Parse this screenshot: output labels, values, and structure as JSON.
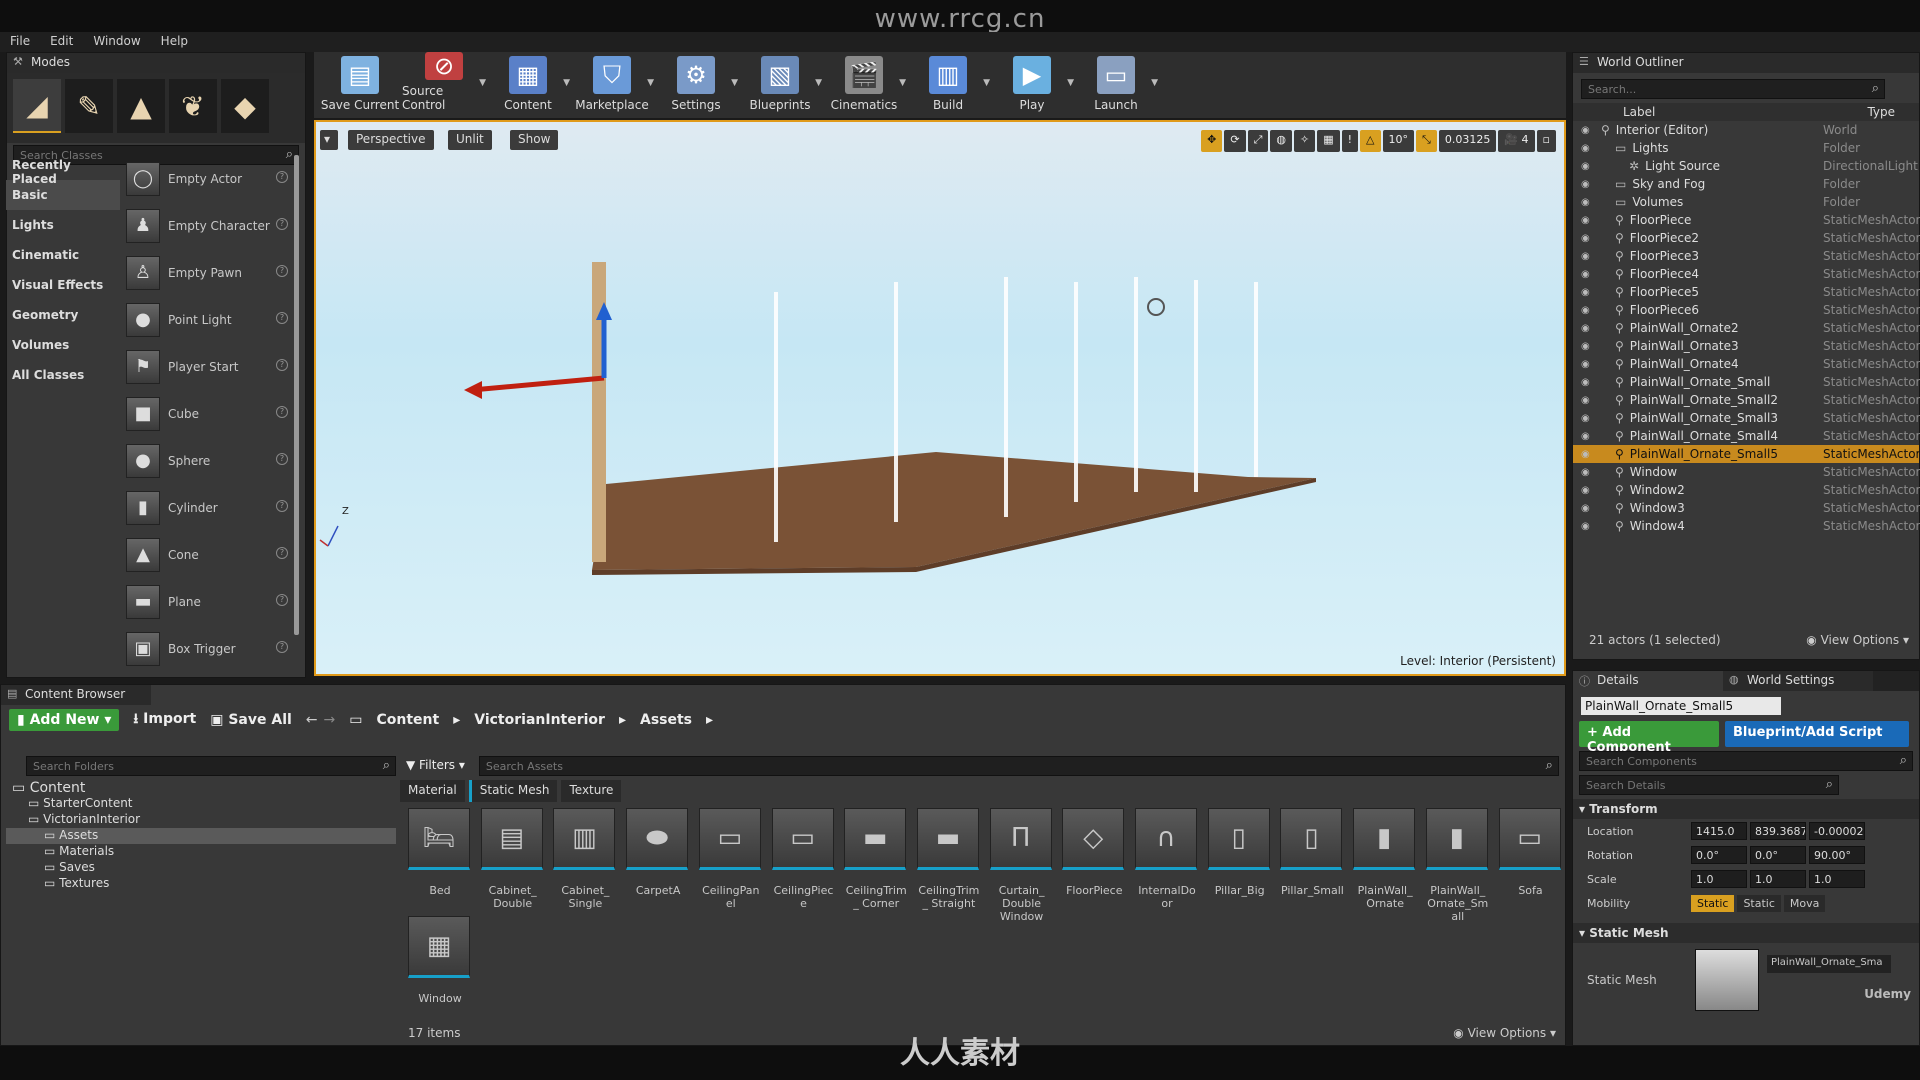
{
  "watermark": "www.rrcg.cn",
  "bottom_logo": "人人素材",
  "menu": [
    "File",
    "Edit",
    "Window",
    "Help"
  ],
  "modes": {
    "title": "Modes",
    "search_placeholder": "Search Classes",
    "categories": [
      "Recently Placed",
      "Basic",
      "Lights",
      "Cinematic",
      "Visual Effects",
      "Geometry",
      "Volumes",
      "All Classes"
    ],
    "selected_category": "Basic",
    "items": [
      "Empty Actor",
      "Empty Character",
      "Empty Pawn",
      "Point Light",
      "Player Start",
      "Cube",
      "Sphere",
      "Cylinder",
      "Cone",
      "Plane",
      "Box Trigger"
    ]
  },
  "toolbar": [
    {
      "label": "Save Current",
      "icon": "save-icon",
      "color": "#7fb2e0"
    },
    {
      "label": "Source Control",
      "icon": "source-control-icon",
      "color": "#c04040"
    },
    {
      "label": "Content",
      "icon": "content-icon",
      "color": "#5a80c8"
    },
    {
      "label": "Marketplace",
      "icon": "marketplace-icon",
      "color": "#6a9ad8"
    },
    {
      "label": "Settings",
      "icon": "settings-icon",
      "color": "#7a9ac8"
    },
    {
      "label": "Blueprints",
      "icon": "blueprints-icon",
      "color": "#6a8ab8"
    },
    {
      "label": "Cinematics",
      "icon": "cinematics-icon",
      "color": "#8a8a8a"
    },
    {
      "label": "Build",
      "icon": "build-icon",
      "color": "#5a8ad8"
    },
    {
      "label": "Play",
      "icon": "play-icon",
      "color": "#6ab0e0"
    },
    {
      "label": "Launch",
      "icon": "launch-icon",
      "color": "#8aa0c0"
    }
  ],
  "viewport": {
    "perspective": "Perspective",
    "unlit": "Unlit",
    "show": "Show",
    "rotation_snap": "10°",
    "scale_snap": "0.03125",
    "camera_speed": "4",
    "level_label": "Level:",
    "level_name": "Interior (Persistent)",
    "axis": "Z"
  },
  "outliner": {
    "title": "World Outliner",
    "search_placeholder": "Search...",
    "col_label": "Label",
    "col_type": "Type",
    "rows": [
      {
        "label": "Interior (Editor)",
        "type": "World",
        "indent": 0,
        "sel": false
      },
      {
        "label": "Lights",
        "type": "Folder",
        "indent": 1,
        "sel": false
      },
      {
        "label": "Light Source",
        "type": "DirectionalLight",
        "indent": 2,
        "sel": false
      },
      {
        "label": "Sky and Fog",
        "type": "Folder",
        "indent": 1,
        "sel": false
      },
      {
        "label": "Volumes",
        "type": "Folder",
        "indent": 1,
        "sel": false
      },
      {
        "label": "FloorPiece",
        "type": "StaticMeshActor",
        "indent": 1,
        "sel": false
      },
      {
        "label": "FloorPiece2",
        "type": "StaticMeshActor",
        "indent": 1,
        "sel": false
      },
      {
        "label": "FloorPiece3",
        "type": "StaticMeshActor",
        "indent": 1,
        "sel": false
      },
      {
        "label": "FloorPiece4",
        "type": "StaticMeshActor",
        "indent": 1,
        "sel": false
      },
      {
        "label": "FloorPiece5",
        "type": "StaticMeshActor",
        "indent": 1,
        "sel": false
      },
      {
        "label": "FloorPiece6",
        "type": "StaticMeshActor",
        "indent": 1,
        "sel": false
      },
      {
        "label": "PlainWall_Ornate2",
        "type": "StaticMeshActor",
        "indent": 1,
        "sel": false
      },
      {
        "label": "PlainWall_Ornate3",
        "type": "StaticMeshActor",
        "indent": 1,
        "sel": false
      },
      {
        "label": "PlainWall_Ornate4",
        "type": "StaticMeshActor",
        "indent": 1,
        "sel": false
      },
      {
        "label": "PlainWall_Ornate_Small",
        "type": "StaticMeshActor",
        "indent": 1,
        "sel": false
      },
      {
        "label": "PlainWall_Ornate_Small2",
        "type": "StaticMeshActor",
        "indent": 1,
        "sel": false
      },
      {
        "label": "PlainWall_Ornate_Small3",
        "type": "StaticMeshActor",
        "indent": 1,
        "sel": false
      },
      {
        "label": "PlainWall_Ornate_Small4",
        "type": "StaticMeshActor",
        "indent": 1,
        "sel": false
      },
      {
        "label": "PlainWall_Ornate_Small5",
        "type": "StaticMeshActor",
        "indent": 1,
        "sel": true
      },
      {
        "label": "Window",
        "type": "StaticMeshActor",
        "indent": 1,
        "sel": false
      },
      {
        "label": "Window2",
        "type": "StaticMeshActor",
        "indent": 1,
        "sel": false
      },
      {
        "label": "Window3",
        "type": "StaticMeshActor",
        "indent": 1,
        "sel": false
      },
      {
        "label": "Window4",
        "type": "StaticMeshActor",
        "indent": 1,
        "sel": false
      }
    ],
    "status": "21 actors (1 selected)",
    "view_options": "View Options"
  },
  "details": {
    "tab_details": "Details",
    "tab_world_settings": "World Settings",
    "actor_name": "PlainWall_Ornate_Small5",
    "add_component": "+ Add Component",
    "blueprint_script": "Blueprint/Add Script",
    "search_components": "Search Components",
    "search_details": "Search Details",
    "transform": "Transform",
    "location_label": "Location",
    "location": [
      "1415.0",
      "839.3687",
      "-0.000023"
    ],
    "rotation_label": "Rotation",
    "rotation": [
      "0.0°",
      "0.0°",
      "90.00°"
    ],
    "scale_label": "Scale",
    "scale": [
      "1.0",
      "1.0",
      "1.0"
    ],
    "mobility_label": "Mobility",
    "mobility": [
      "Static",
      "Static",
      "Mova"
    ],
    "static_mesh_section": "Static Mesh",
    "static_mesh_label": "Static Mesh",
    "static_mesh_value": "PlainWall_Ornate_Sma",
    "udemy": "Udemy"
  },
  "content_browser": {
    "title": "Content Browser",
    "add_new": "Add New",
    "import": "Import",
    "save_all": "Save All",
    "path": [
      "Content",
      "VictorianInterior",
      "Assets"
    ],
    "search_folders": "Search Folders",
    "filters": "Filters",
    "search_assets": "Search Assets",
    "filter_tabs": [
      "Material",
      "Static Mesh",
      "Texture"
    ],
    "folders": [
      {
        "name": "Content",
        "indent": 0
      },
      {
        "name": "StarterContent",
        "indent": 1
      },
      {
        "name": "VictorianInterior",
        "indent": 1
      },
      {
        "name": "Assets",
        "indent": 2,
        "sel": true
      },
      {
        "name": "Materials",
        "indent": 2
      },
      {
        "name": "Saves",
        "indent": 2
      },
      {
        "name": "Textures",
        "indent": 2
      }
    ],
    "assets": [
      "Bed",
      "Cabinet_ Double",
      "Cabinet_ Single",
      "CarpetA",
      "CeilingPanel",
      "CeilingPiece",
      "CeilingTrim_ Corner",
      "CeilingTrim_ Straight",
      "Curtain_ Double Window",
      "FloorPiece",
      "InternalDoor",
      "Pillar_Big",
      "Pillar_Small",
      "PlainWall_ Ornate",
      "PlainWall_ Ornate_Small",
      "Sofa",
      "Window"
    ],
    "item_count": "17 items",
    "view_options": "View Options"
  }
}
